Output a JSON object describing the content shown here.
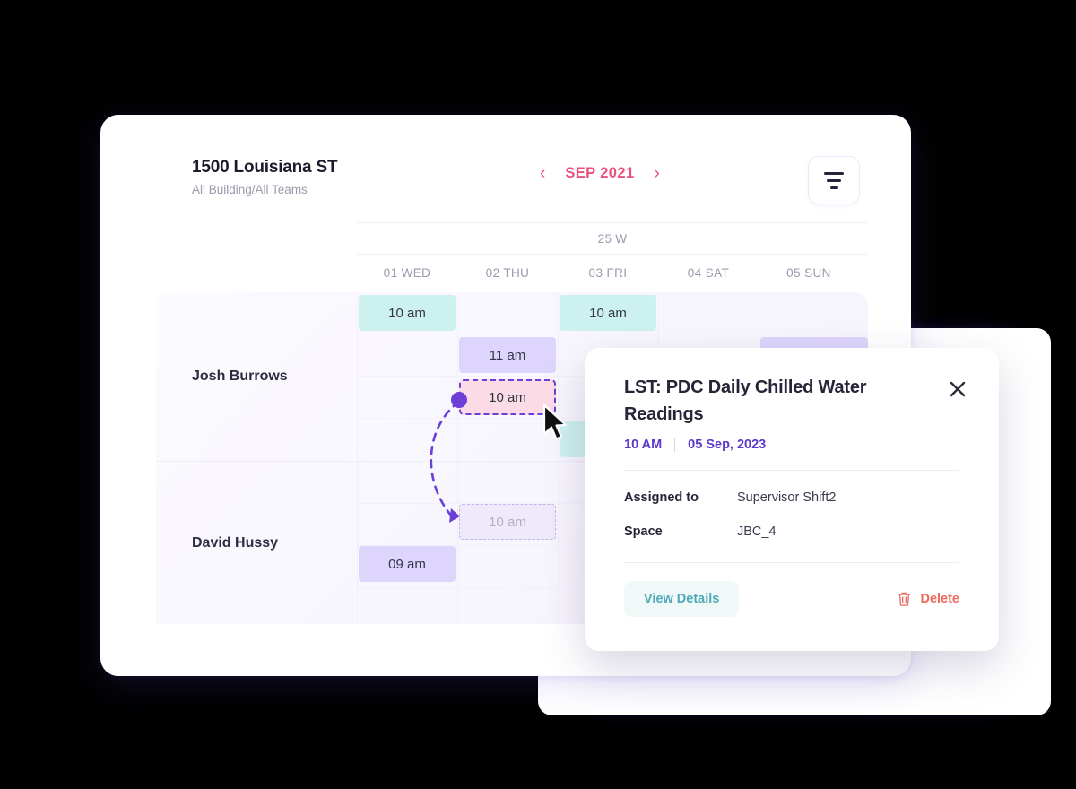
{
  "header": {
    "title": "1500 Louisiana ST",
    "subtitle": "All Building/All Teams",
    "prev_icon": "‹",
    "next_icon": "›",
    "month": "SEP 2021",
    "filter_icon": "filter-icon"
  },
  "calendar": {
    "week_label": "25 W",
    "days": [
      "01 WED",
      "02 THU",
      "03 FRI",
      "04 SAT",
      "05 SUN"
    ],
    "people": [
      "Josh Burrows",
      "David Hussy"
    ],
    "events": [
      {
        "label": "10 am",
        "col": 0,
        "slot": 0,
        "style": "teal",
        "row": "Josh Burrows"
      },
      {
        "label": "10 am",
        "col": 2,
        "slot": 0,
        "style": "teal",
        "row": "Josh Burrows"
      },
      {
        "label": "11 am",
        "col": 1,
        "slot": 1,
        "style": "purple",
        "row": "Josh Burrows"
      },
      {
        "label": "10 am",
        "col": 1,
        "slot": 2,
        "style": "drag",
        "row": "Josh Burrows"
      },
      {
        "label": "",
        "col": 4,
        "slot": 1,
        "style": "purple",
        "row": "Josh Burrows"
      },
      {
        "label": "",
        "col": 2,
        "slot": 3,
        "style": "teal",
        "row": "Josh Burrows"
      },
      {
        "label": "10 am",
        "col": 1,
        "slot": 0,
        "style": "ghost",
        "row": "David Hussy"
      },
      {
        "label": "09 am",
        "col": 0,
        "slot": 1,
        "style": "purple",
        "row": "David Hussy"
      },
      {
        "label": "",
        "col": 4,
        "slot": 2,
        "style": "teal",
        "row": "David Hussy"
      }
    ]
  },
  "popup": {
    "title": "LST: PDC Daily Chilled Water Readings",
    "close_icon": "close-icon",
    "time": "10 AM",
    "date": "05 Sep, 2023",
    "fields": [
      {
        "key": "Assigned to",
        "value": "Supervisor Shift2"
      },
      {
        "key": "Space",
        "value": "JBC_4"
      }
    ],
    "view_label": "View Details",
    "delete_label": "Delete",
    "delete_icon": "trash-icon"
  },
  "colors": {
    "accent_pink": "#e8517f",
    "accent_purple": "#5b37cc",
    "event_teal": "#cdf1ee",
    "event_purple": "#ddd5fb",
    "event_drag": "#fbdbe5",
    "view_btn": "#4fa9b8",
    "delete": "#ec6a5e",
    "glow": "#5a35c9"
  }
}
